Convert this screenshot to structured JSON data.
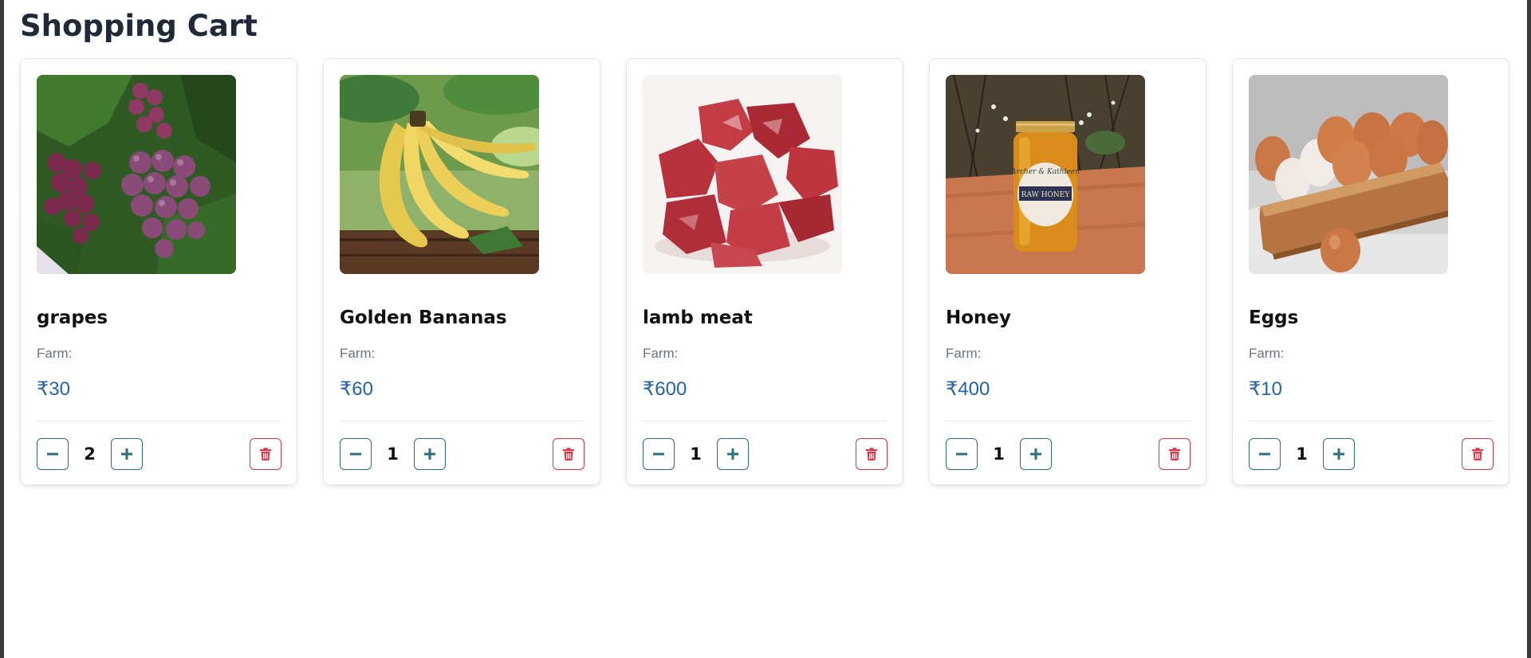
{
  "page": {
    "title": "Shopping Cart"
  },
  "colors": {
    "accent": "#2b6f7a",
    "price": "#2563a8",
    "danger": "#dc3545",
    "muted": "#6b7280"
  },
  "cart": {
    "items": [
      {
        "name": "grapes",
        "farm_label": "Farm:",
        "price": "₹30",
        "quantity": "2",
        "image": "grapes"
      },
      {
        "name": "Golden Bananas",
        "farm_label": "Farm:",
        "price": "₹60",
        "quantity": "1",
        "image": "bananas"
      },
      {
        "name": "lamb meat",
        "farm_label": "Farm:",
        "price": "₹600",
        "quantity": "1",
        "image": "meat"
      },
      {
        "name": "Honey",
        "farm_label": "Farm:",
        "price": "₹400",
        "quantity": "1",
        "image": "honey"
      },
      {
        "name": "Eggs",
        "farm_label": "Farm:",
        "price": "₹10",
        "quantity": "1",
        "image": "eggs"
      }
    ]
  },
  "icons": {
    "decrement": "minus-icon",
    "increment": "plus-icon",
    "remove": "trash-icon"
  },
  "honey_label": {
    "top": "Archer & Kathleen",
    "band": "RAW HONEY"
  }
}
